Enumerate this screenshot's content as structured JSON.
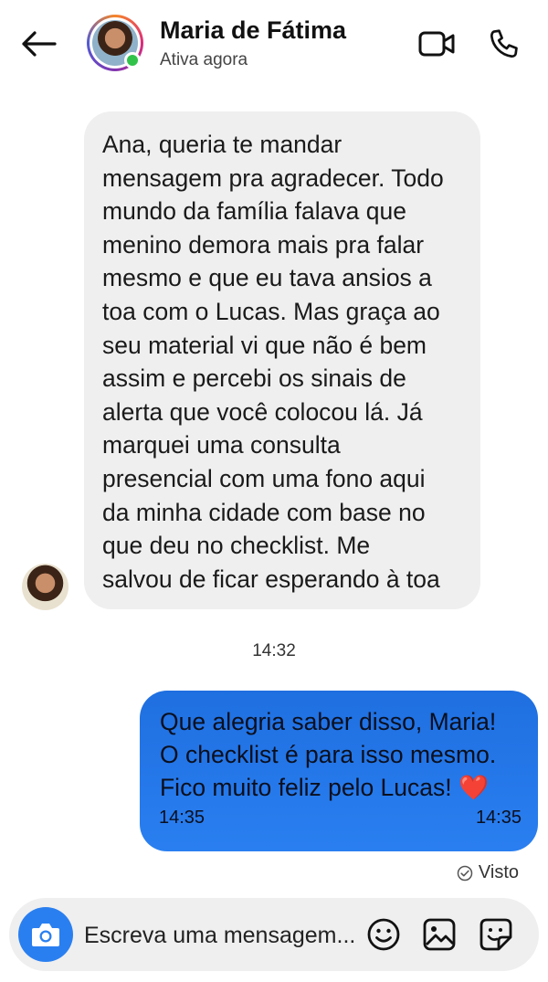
{
  "header": {
    "contact_name": "Maria de Fátima",
    "status": "Ativa agora",
    "icons": {
      "back": "arrow-left-icon",
      "video": "video-camera-icon",
      "call": "phone-icon"
    }
  },
  "messages": {
    "received": {
      "lines": [
        "Ana, queria te mandar",
        "mensagem pra agradecer. Todo",
        "mundo da família falava que",
        "menino demora mais pra falar",
        "mesmo e que eu tava ansios a",
        "toa com o Lucas. Mas graça ao",
        "seu material vi que não é bem",
        "assim e percebi os sinais de",
        "alerta que você colocou lá. Já",
        "marquei uma consulta",
        "presencial com uma fono aqui",
        "da minha cidade com base no",
        "que deu no checklist. Me",
        "salvou de ficar esperando à toa"
      ],
      "time": "14:32"
    },
    "sent": {
      "lines": [
        "Que alegria saber disso, Maria!",
        "O checklist é para isso mesmo.",
        "Fico muito feliz pelo Lucas!"
      ],
      "emoji": "❤️",
      "time_left": "14:35",
      "time_right": "14:35",
      "seen_label": "Visto"
    }
  },
  "composer": {
    "placeholder": "Escreva uma mensagem...",
    "icons": {
      "camera": "camera-icon",
      "emoji": "smiley-icon",
      "gallery": "image-icon",
      "sticker": "sticker-icon"
    }
  },
  "colors": {
    "sent_bubble": "#2a7ff0",
    "received_bubble": "#efefef",
    "online": "#31c24a"
  }
}
